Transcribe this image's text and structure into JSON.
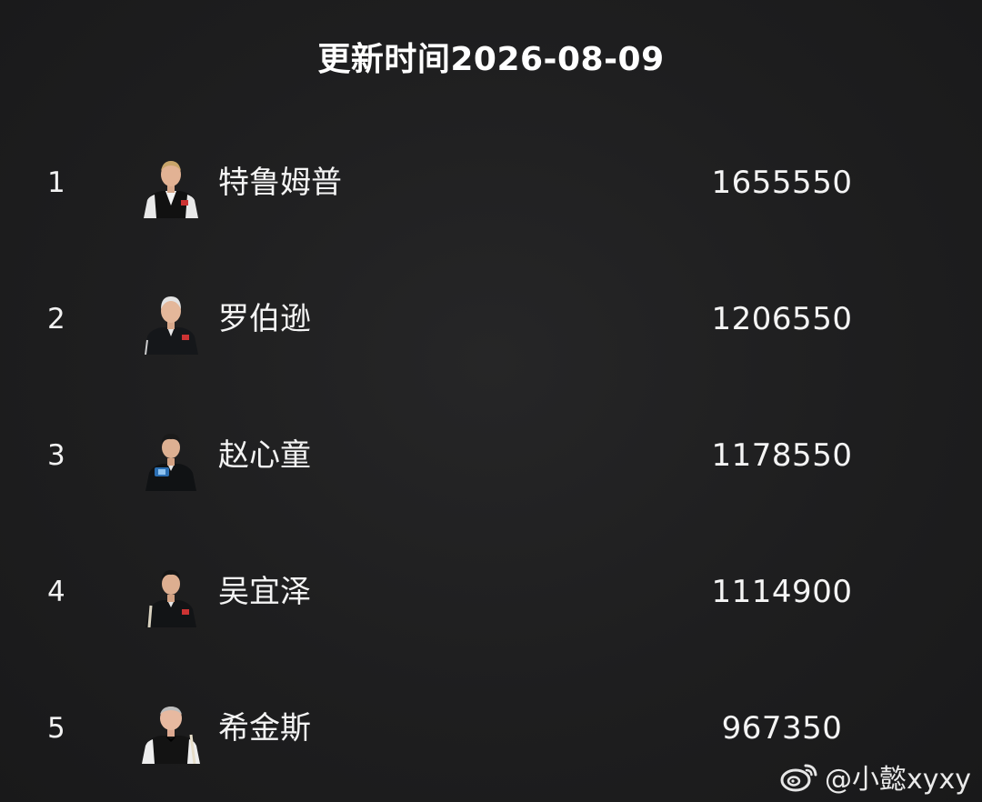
{
  "header": {
    "title": "更新时间2026-08-09"
  },
  "rankings": [
    {
      "rank": "1",
      "name": "特鲁姆普",
      "amount": "1655550",
      "avatar_icon": "player-portrait-icon"
    },
    {
      "rank": "2",
      "name": "罗伯逊",
      "amount": "1206550",
      "avatar_icon": "player-portrait-icon"
    },
    {
      "rank": "3",
      "name": "赵心童",
      "amount": "1178550",
      "avatar_icon": "player-portrait-icon"
    },
    {
      "rank": "4",
      "name": "吴宜泽",
      "amount": "1114900",
      "avatar_icon": "player-portrait-icon"
    },
    {
      "rank": "5",
      "name": "希金斯",
      "amount": "967350",
      "avatar_icon": "player-portrait-icon"
    }
  ],
  "watermark": {
    "text": "@小懿xyxy",
    "icon": "weibo-icon"
  },
  "colors": {
    "background": "#1d1d1e",
    "text": "#f2f2f2"
  }
}
